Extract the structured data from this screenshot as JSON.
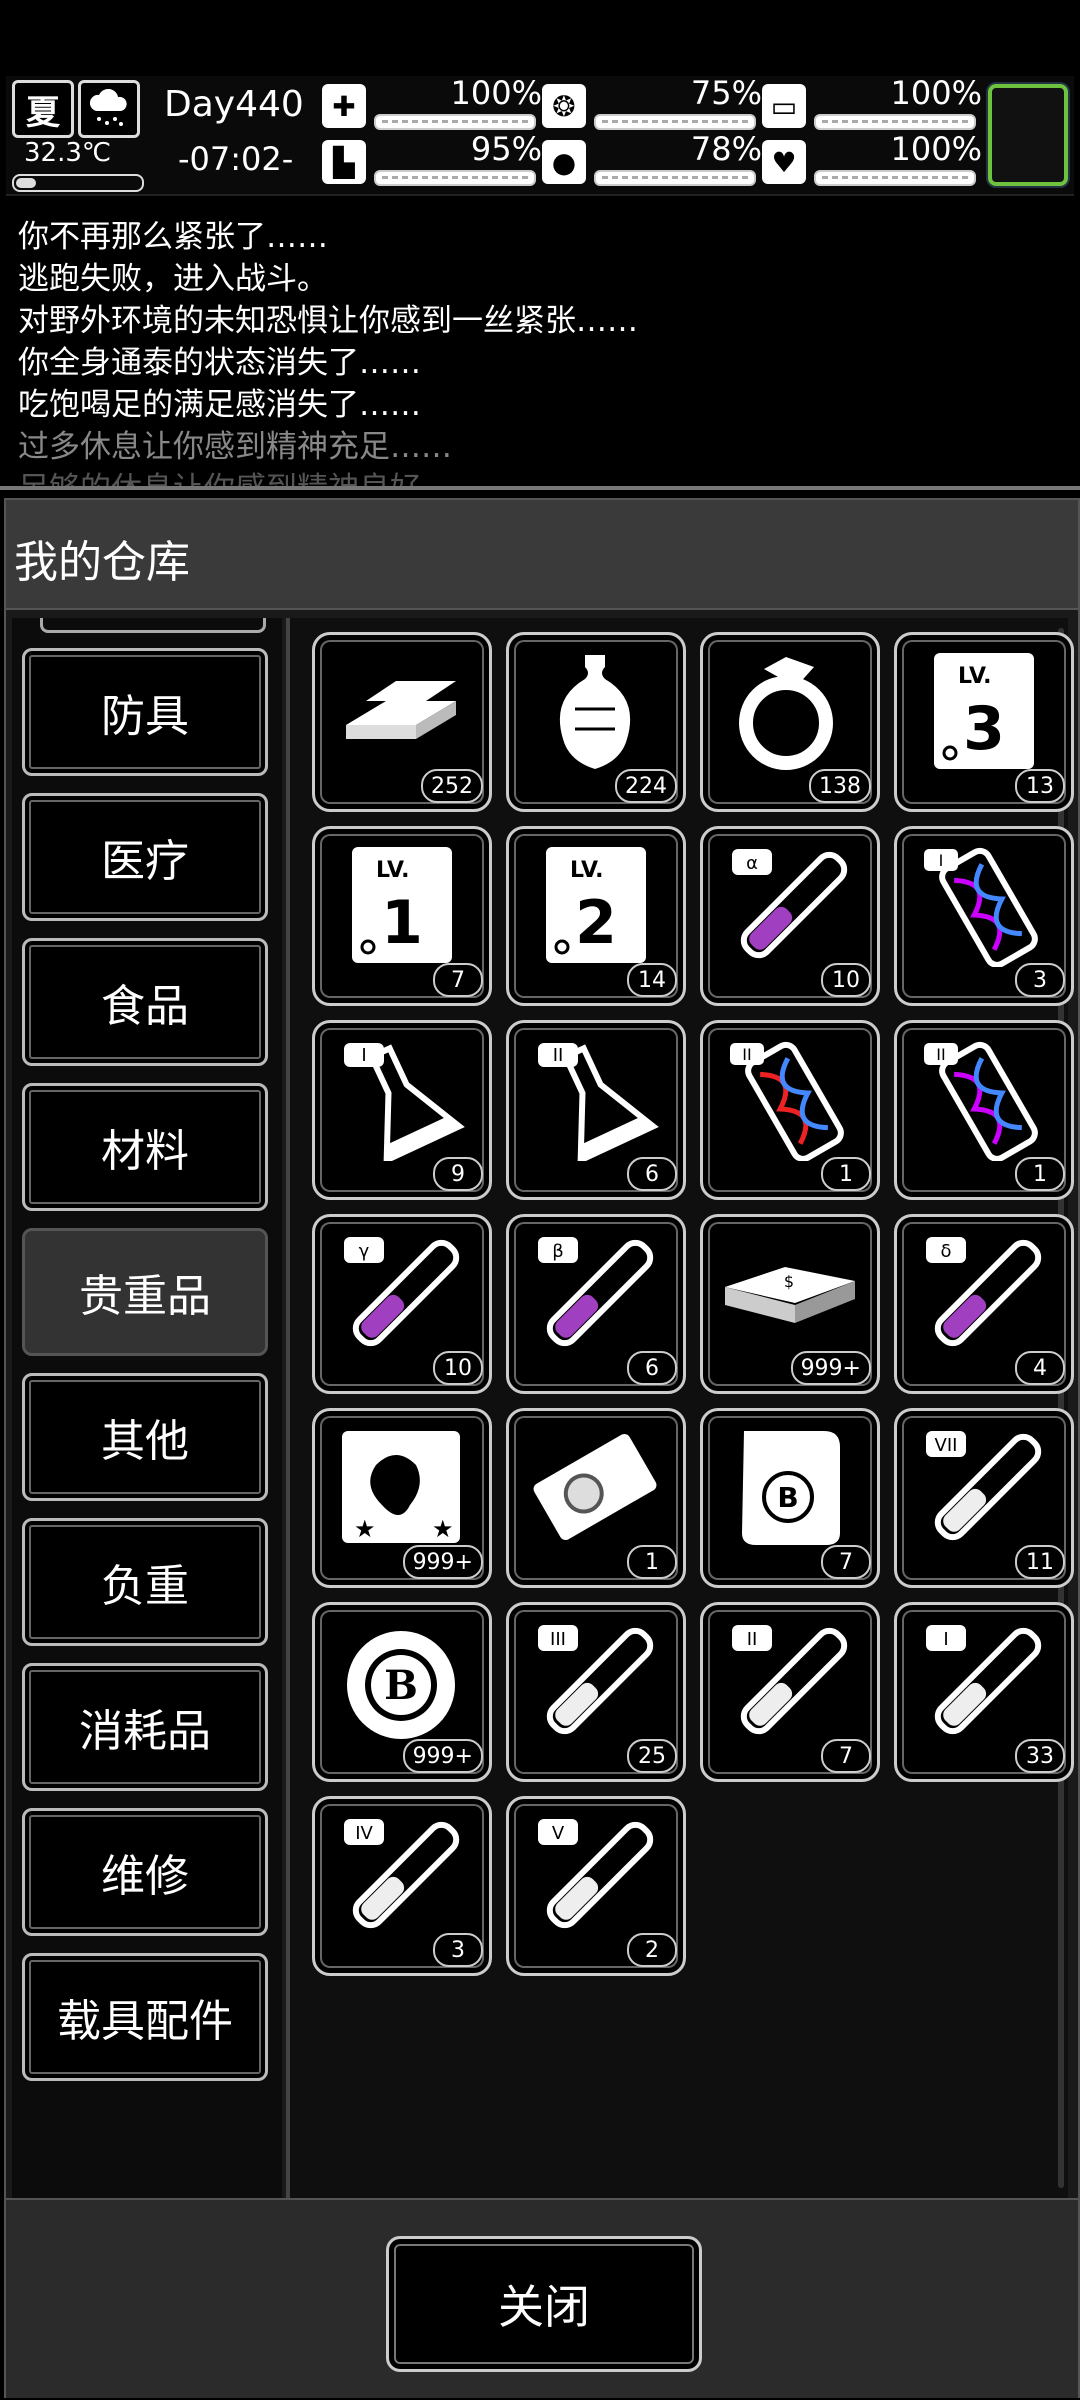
{
  "status": {
    "season": "夏",
    "temperature": "32.3℃",
    "day": "Day440",
    "time": "-07:02-",
    "stats": [
      {
        "icon": "medkit-icon",
        "glyph": "+",
        "pct": "100%",
        "level": 1.0
      },
      {
        "icon": "stomach-icon",
        "glyph": "❂",
        "pct": "75%",
        "level": 0.75
      },
      {
        "icon": "battery-icon",
        "glyph": "▭",
        "pct": "100%",
        "level": 1.0
      },
      {
        "icon": "boot-icon",
        "glyph": "⌐",
        "pct": "95%",
        "level": 0.95
      },
      {
        "icon": "water-drop-icon",
        "glyph": "💧",
        "pct": "78%",
        "level": 0.78
      },
      {
        "icon": "heart-icon",
        "glyph": "♥",
        "pct": "100%",
        "level": 1.0
      }
    ]
  },
  "log": [
    "你不再那么紧张了……",
    "逃跑失败，进入战斗。",
    "对野外环境的未知恐惧让你感到一丝紧张……",
    "你全身通泰的状态消失了……",
    "吃饱喝足的满足感消失了……",
    "过多休息让你感到精神充足……",
    "足够的休息让你感到精神良好……"
  ],
  "panel": {
    "title": "我的仓库",
    "categories": [
      "防具",
      "医疗",
      "食品",
      "材料",
      "贵重品",
      "其他",
      "负重",
      "消耗品",
      "维修",
      "载具配件"
    ],
    "active_category": "贵重品",
    "close_label": "关闭"
  },
  "items": [
    {
      "icon": "gold-bars-icon",
      "count": "252"
    },
    {
      "icon": "vase-icon",
      "count": "224"
    },
    {
      "icon": "diamond-ring-icon",
      "count": "138"
    },
    {
      "icon": "skill-book-lv3-icon",
      "label": "3",
      "count": "13"
    },
    {
      "icon": "skill-book-lv1-icon",
      "label": "1",
      "count": "7"
    },
    {
      "icon": "skill-book-lv2-icon",
      "label": "2",
      "count": "14"
    },
    {
      "icon": "test-tube-alpha-icon",
      "label": "α",
      "count": "10"
    },
    {
      "icon": "gene-capsule-1-icon",
      "label": "I",
      "count": "3"
    },
    {
      "icon": "flask-1-icon",
      "label": "I",
      "count": "9"
    },
    {
      "icon": "flask-2-icon",
      "label": "II",
      "count": "6"
    },
    {
      "icon": "gene-capsule-2-red-icon",
      "label": "II",
      "count": "1"
    },
    {
      "icon": "gene-capsule-2-icon",
      "label": "II",
      "count": "1"
    },
    {
      "icon": "test-tube-gamma-icon",
      "label": "γ",
      "count": "10"
    },
    {
      "icon": "test-tube-beta-icon",
      "label": "β",
      "count": "6"
    },
    {
      "icon": "cash-stack-icon",
      "count": "999+"
    },
    {
      "icon": "test-tube-delta-icon",
      "label": "δ",
      "count": "4"
    },
    {
      "icon": "monster-card-icon",
      "count": "999+"
    },
    {
      "icon": "portrait-ticket-icon",
      "count": "1"
    },
    {
      "icon": "bitcoin-scroll-icon",
      "count": "7"
    },
    {
      "icon": "test-tube-7-icon",
      "label": "VII",
      "count": "11"
    },
    {
      "icon": "bitcoin-chip-icon",
      "label": "B",
      "count": "999+"
    },
    {
      "icon": "test-tube-3-icon",
      "label": "III",
      "count": "25"
    },
    {
      "icon": "test-tube-2-icon",
      "label": "II",
      "count": "7"
    },
    {
      "icon": "test-tube-1-icon",
      "label": "I",
      "count": "33"
    },
    {
      "icon": "test-tube-4-icon",
      "label": "IV",
      "count": "3"
    },
    {
      "icon": "test-tube-5-icon",
      "label": "V",
      "count": "2"
    }
  ]
}
